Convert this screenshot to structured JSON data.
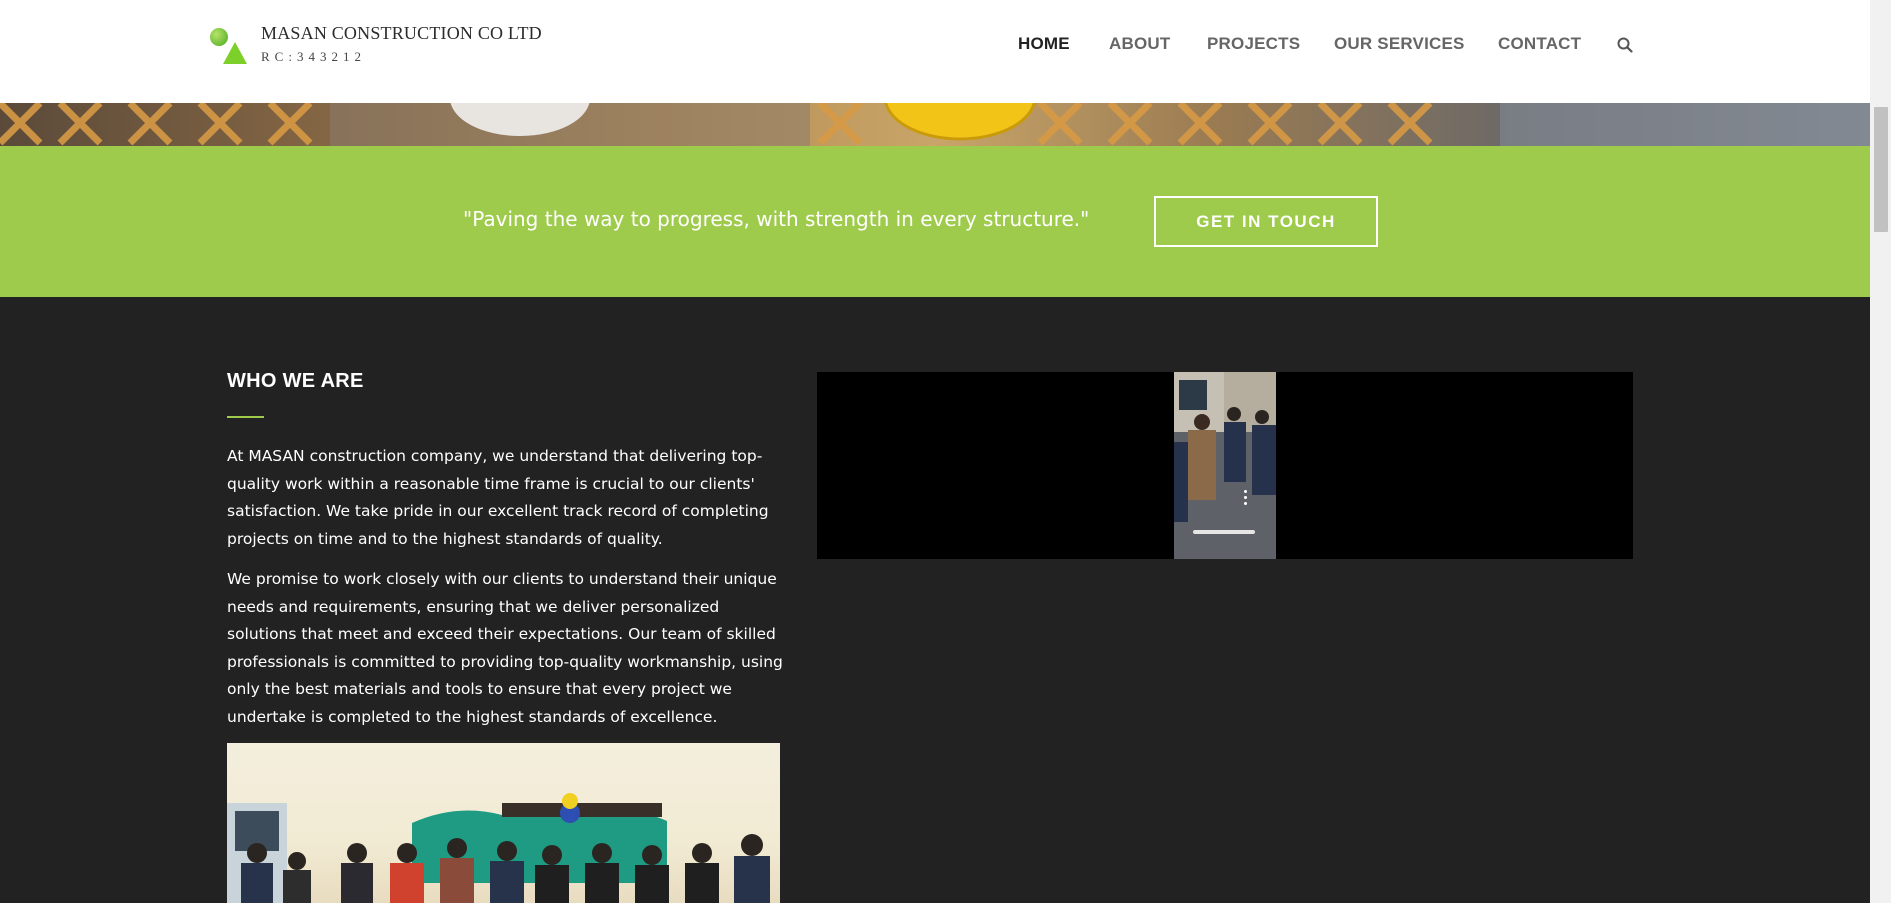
{
  "header": {
    "logo_title": "MASAN CONSTRUCTION CO LTD",
    "logo_rc": "RC:343212",
    "nav": [
      {
        "label": "HOME",
        "active": true
      },
      {
        "label": "ABOUT",
        "active": false
      },
      {
        "label": "PROJECTS",
        "active": false
      },
      {
        "label": "OUR SERVICES",
        "active": false
      },
      {
        "label": "CONTACT",
        "active": false
      }
    ],
    "search_icon": "search-icon"
  },
  "cta": {
    "quote": "\"Paving the way to progress, with strength in every structure.\"",
    "button_label": "GET IN TOUCH"
  },
  "who": {
    "title": "WHO WE ARE",
    "paragraph1": "At MASAN construction company, we understand that delivering top-quality work within a reasonable time frame is crucial to our clients' satisfaction. We take pride in our excellent track record of completing projects on time and to the highest standards of quality.",
    "paragraph2": "We promise to work closely with our clients to understand their unique needs and requirements, ensuring that we deliver personalized solutions that meet and exceed their expectations. Our team of skilled professionals is committed to providing top-quality workmanship, using only the best materials and tools to ensure that every project we undertake is completed to the highest standards of excellence."
  },
  "colors": {
    "accent_green": "#9fcb4d",
    "dark_bg": "#222222",
    "header_bg": "#ffffff"
  }
}
